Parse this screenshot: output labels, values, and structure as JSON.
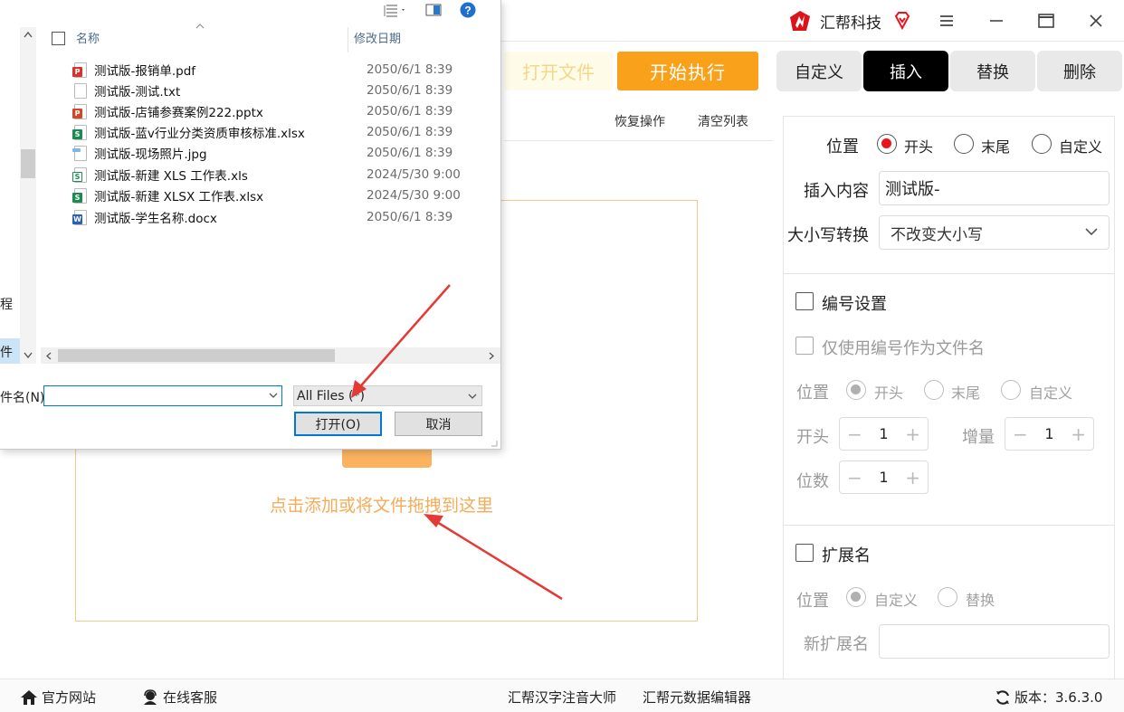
{
  "app": {
    "brand_name": "汇帮科技",
    "window_controls": [
      "menu-icon",
      "minimize-icon",
      "maximize-icon",
      "close-icon"
    ]
  },
  "toolbar": {
    "faded_button": "打开文件",
    "start_label": "开始执行",
    "tabs": [
      {
        "label": "自定义",
        "active": false
      },
      {
        "label": "插入",
        "active": true
      },
      {
        "label": "替换",
        "active": false
      },
      {
        "label": "删除",
        "active": false
      }
    ],
    "restore_label": "恢复操作",
    "clear_label": "清空列表"
  },
  "dropzone": {
    "hint": "点击添加或将文件拖拽到这里"
  },
  "settings": {
    "position_label": "位置",
    "position_options": [
      "开头",
      "末尾",
      "自定义"
    ],
    "position_selected": "开头",
    "insert_label": "插入内容",
    "insert_value": "测试版-",
    "case_label": "大小写转换",
    "case_value": "不改变大小写",
    "numbering_label": "编号设置",
    "numbering_only_label": "仅使用编号作为文件名",
    "num_position_label": "位置",
    "num_position_options": [
      "开头",
      "末尾",
      "自定义"
    ],
    "start_label": "开头",
    "start_value": "1",
    "increment_label": "增量",
    "increment_value": "1",
    "digits_label": "位数",
    "digits_value": "1",
    "ext_label": "扩展名",
    "ext_position_label": "位置",
    "ext_position_options": [
      "自定义",
      "替换"
    ],
    "new_ext_label": "新扩展名",
    "new_ext_value": ""
  },
  "footer": {
    "website": "官方网站",
    "support": "在线客服",
    "product1": "汇帮汉字注音大师",
    "product2": "汇帮元数据编辑器",
    "version": "版本：3.6.3.0"
  },
  "dialog": {
    "col_name": "名称",
    "col_date": "修改日期",
    "nav_items": [
      "程",
      "件"
    ],
    "files": [
      {
        "name": "测试版-报销单.pdf",
        "date": "2050/6/1 8:39",
        "type": "pdf"
      },
      {
        "name": "测试版-测试.txt",
        "date": "2050/6/1 8:39",
        "type": "txt"
      },
      {
        "name": "测试版-店铺参赛案例222.pptx",
        "date": "2050/6/1 8:39",
        "type": "pptx"
      },
      {
        "name": "测试版-蓝v行业分类资质审核标准.xlsx",
        "date": "2050/6/1 8:39",
        "type": "xlsx"
      },
      {
        "name": "测试版-现场照片.jpg",
        "date": "2050/6/1 8:39",
        "type": "jpg"
      },
      {
        "name": "测试版-新建 XLS 工作表.xls",
        "date": "2024/5/30 9:00",
        "type": "xls"
      },
      {
        "name": "测试版-新建 XLSX 工作表.xlsx",
        "date": "2024/5/30 9:00",
        "type": "xlsx"
      },
      {
        "name": "测试版-学生名称.docx",
        "date": "2050/6/1 8:39",
        "type": "docx"
      }
    ],
    "filename_label": "件名(N):",
    "filename_value": "",
    "filetype_value": "All Files (*)",
    "open_label": "打开(O)",
    "cancel_label": "取消"
  },
  "colors": {
    "accent": "#f9a11b",
    "radio_on": "#e8141c",
    "drop_border": "#f6c98a",
    "drop_hint": "#f3ac5a",
    "arrow": "#e53935"
  }
}
